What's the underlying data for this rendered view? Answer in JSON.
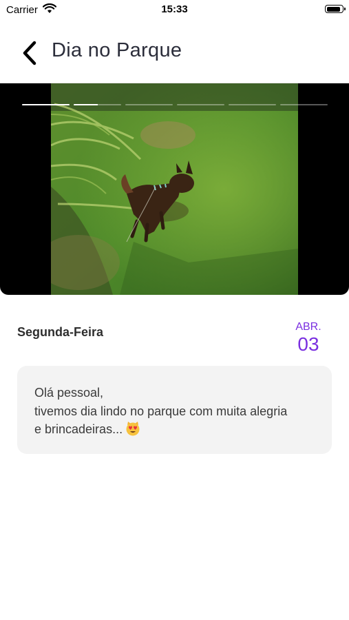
{
  "status_bar": {
    "carrier": "Carrier",
    "time": "15:33",
    "battery_level": 0.9
  },
  "nav": {
    "title": "Dia no Parque",
    "back_icon": "chevron-left-icon"
  },
  "story": {
    "segments": [
      1,
      0.5,
      0,
      0,
      0,
      0
    ],
    "photo_description": "dog-on-grass-photo"
  },
  "post": {
    "day_of_week": "Segunda-Feira",
    "month": "ABR.",
    "day": "03",
    "message": {
      "line1": "Olá pessoal,",
      "line2": "tivemos dia lindo no parque com muita alegria",
      "line3": "e brincadeiras...",
      "emoji_icon": "heart-eyes-cat-emoji-icon"
    }
  },
  "colors": {
    "accent": "#7a2fe0",
    "card_bg": "#f3f3f3",
    "title": "#2b2d3a"
  }
}
